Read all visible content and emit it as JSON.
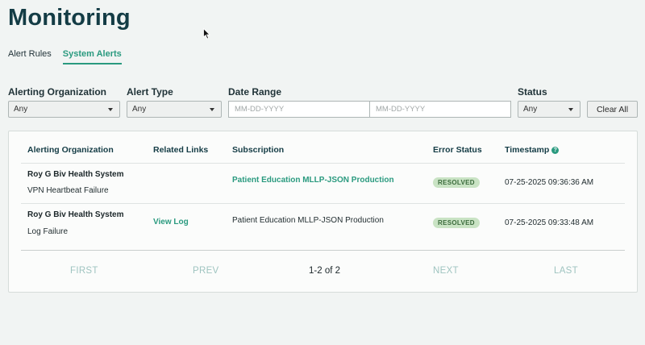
{
  "header": {
    "title": "Monitoring"
  },
  "tabs": [
    {
      "label": "Alert Rules",
      "active": false
    },
    {
      "label": "System Alerts",
      "active": true
    }
  ],
  "filters": {
    "org_label": "Alerting Organization",
    "org_value": "Any",
    "type_label": "Alert Type",
    "type_value": "Any",
    "date_label": "Date Range",
    "date_start_placeholder": "MM-DD-YYYY",
    "date_end_placeholder": "MM-DD-YYYY",
    "status_label": "Status",
    "status_value": "Any",
    "clear_label": "Clear All"
  },
  "table": {
    "columns": [
      "Alerting Organization",
      "Related Links",
      "Subscription",
      "Error Status",
      "Timestamp"
    ],
    "rows": [
      {
        "org": "Roy G Biv Health System",
        "alert": "VPN Heartbeat Failure",
        "link": "",
        "subscription": "Patient Education MLLP-JSON Production",
        "status": "RESOLVED",
        "timestamp": "07-25-2025 09:36:36 AM"
      },
      {
        "org": "Roy G Biv Health System",
        "alert": "Log Failure",
        "link": "View Log",
        "subscription": "Patient Education MLLP-JSON Production",
        "status": "RESOLVED",
        "timestamp": "07-25-2025 09:33:48 AM"
      }
    ]
  },
  "pagination": {
    "first": "FIRST",
    "prev": "PREV",
    "info": "1-2 of 2",
    "next": "NEXT",
    "last": "LAST"
  },
  "colors": {
    "accent": "#2a9a7f",
    "title": "#143c45",
    "badge_bg": "#c9e3c4",
    "background": "#f1f4f3"
  }
}
